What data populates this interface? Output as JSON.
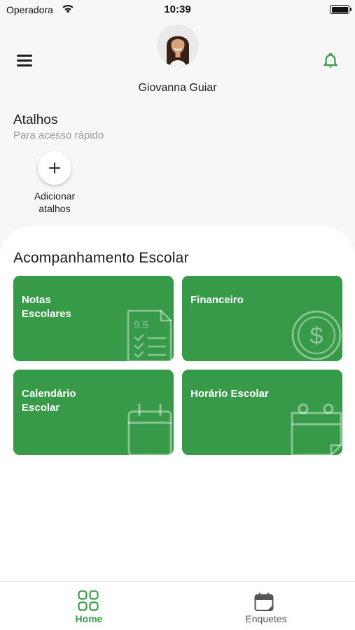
{
  "status_bar": {
    "carrier": "Operadora",
    "time": "10:39",
    "battery_level": 1.0
  },
  "header": {
    "user_name": "Giovanna Guiar",
    "menu_icon": "hamburger-menu-icon",
    "notification_icon": "bell-icon",
    "avatar": "user-avatar"
  },
  "shortcuts": {
    "title": "Atalhos",
    "subtitle": "Para acesso rápido",
    "add_label": "Adicionar\natalhos",
    "add_icon": "plus-icon"
  },
  "school": {
    "title": "Acompanhamento Escolar",
    "cards": [
      {
        "label": "Notas\nEscolares",
        "icon": "grades-checklist-icon"
      },
      {
        "label": "Financeiro",
        "icon": "dollar-coin-icon"
      },
      {
        "label": "Calendário\nEscolar",
        "icon": "calendar-icon"
      },
      {
        "label": "Horário Escolar",
        "icon": "schedule-calendar-icon"
      }
    ]
  },
  "tabbar": {
    "items": [
      {
        "label": "Home",
        "icon": "grid-icon",
        "active": true
      },
      {
        "label": "Enquetes",
        "icon": "polls-calendar-icon",
        "active": false
      }
    ]
  },
  "colors": {
    "accent": "#379a48",
    "background": "#f7f7f7",
    "panel": "#ffffff",
    "muted_text": "#9b9b9b"
  }
}
